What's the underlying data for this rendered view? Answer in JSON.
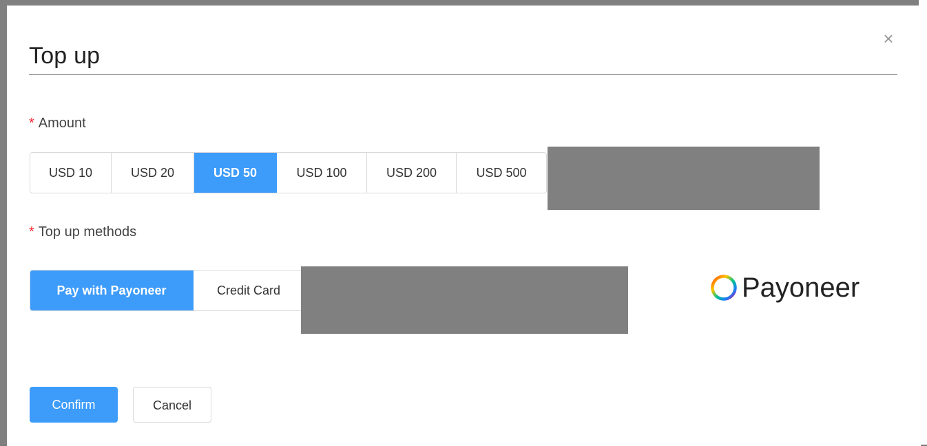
{
  "dialog": {
    "title": "Top up",
    "close_glyph": "×"
  },
  "amount": {
    "label": "Amount",
    "required_mark": "*",
    "options": [
      {
        "label": "USD 10",
        "selected": false
      },
      {
        "label": "USD 20",
        "selected": false
      },
      {
        "label": "USD 50",
        "selected": true
      },
      {
        "label": "USD 100",
        "selected": false
      },
      {
        "label": "USD 200",
        "selected": false
      },
      {
        "label": "USD 500",
        "selected": false
      }
    ]
  },
  "methods": {
    "label": "Top up methods",
    "required_mark": "*",
    "options": [
      {
        "label": "Pay with Payoneer",
        "selected": true
      },
      {
        "label": "Credit Card",
        "selected": false
      }
    ]
  },
  "brand": {
    "name": "Payoneer",
    "icon": "payoneer-ring-icon"
  },
  "actions": {
    "confirm_label": "Confirm",
    "cancel_label": "Cancel"
  },
  "colors": {
    "accent": "#3d9bfa",
    "required": "#f5222d",
    "redaction": "#808080"
  }
}
